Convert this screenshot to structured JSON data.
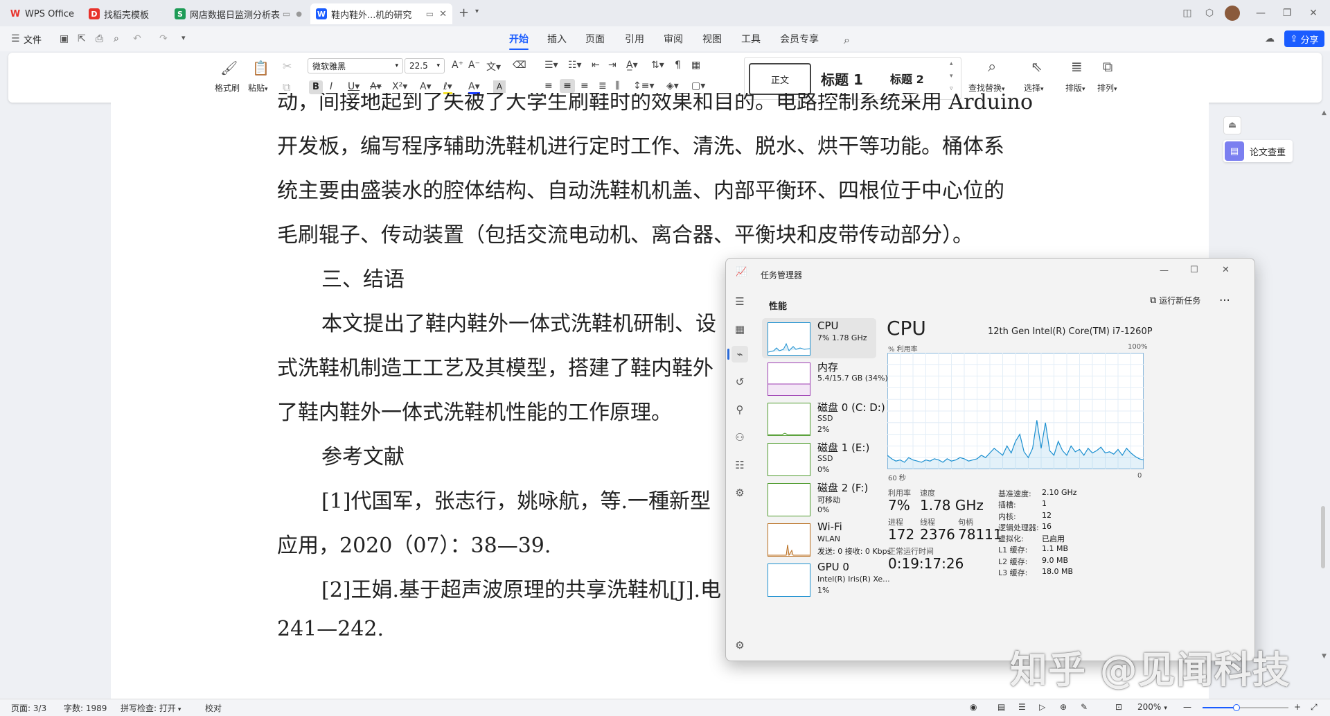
{
  "tabs": [
    {
      "label": "WPS Office",
      "icon": "wps-logo-icon",
      "color": "#e8322b"
    },
    {
      "label": "找稻壳模板",
      "icon": "docer-icon",
      "color": "#e8322b"
    },
    {
      "label": "网店数据日监测分析表",
      "icon": "spreadsheet-icon",
      "color": "#1d9b56"
    },
    {
      "label": "鞋内鞋外...机的研究",
      "icon": "writer-icon",
      "color": "#1a5cff"
    }
  ],
  "menu": {
    "file": "文件",
    "items": [
      "开始",
      "插入",
      "页面",
      "引用",
      "审阅",
      "视图",
      "工具",
      "会员专享"
    ],
    "active": "开始",
    "share": "分享"
  },
  "ribbon": {
    "format_painter": "格式刷",
    "paste": "粘贴",
    "font_name": "微软雅黑",
    "font_size": "22.5",
    "styles": [
      "正文",
      "标题 1",
      "标题 2"
    ],
    "find_replace": "查找替换",
    "select": "选择",
    "layout": "排版",
    "arrange": "排列"
  },
  "document": {
    "lines": [
      "动，间接地起到了失被了大学生刷鞋时的效果和目的。电路控制系统采用 Arduino",
      "开发板，编写程序辅助洗鞋机进行定时工作、清洗、脱水、烘干等功能。桶体系",
      "统主要由盛装水的腔体结构、自动洗鞋机机盖、内部平衡环、四根位于中心位的",
      "毛刷辊子、传动装置（包括交流电动机、离合器、平衡块和皮带传动部分）。",
      "三、结语",
      "本文提出了鞋内鞋外一体式洗鞋机研制、设",
      "式洗鞋机制造工工艺及其模型，搭建了鞋内鞋外",
      "了鞋内鞋外一体式洗鞋机性能的工作原理。",
      "参考文献",
      "[1]代国军，张志行，姚咏航，等.一種新型",
      "应用，2020（07）：38—39.",
      "[2]王娟.基于超声波原理的共享洗鞋机[J].电",
      "241—242."
    ]
  },
  "side_panel": {
    "paper_check": "论文查重"
  },
  "task_manager": {
    "title": "任务管理器",
    "section": "性能",
    "run_new_task": "运行新任务",
    "items": [
      {
        "title": "CPU",
        "lines": [
          "7% 1.78 GHz"
        ]
      },
      {
        "title": "内存",
        "lines": [
          "5.4/15.7 GB (34%)"
        ]
      },
      {
        "title": "磁盘 0 (C: D:)",
        "lines": [
          "SSD",
          "2%"
        ]
      },
      {
        "title": "磁盘 1 (E:)",
        "lines": [
          "SSD",
          "0%"
        ]
      },
      {
        "title": "磁盘 2 (F:)",
        "lines": [
          "可移动",
          "0%"
        ]
      },
      {
        "title": "Wi-Fi",
        "lines": [
          "WLAN",
          "发送: 0 接收: 0 Kbps"
        ]
      },
      {
        "title": "GPU 0",
        "lines": [
          "Intel(R) Iris(R) Xe...",
          "1%"
        ]
      }
    ],
    "cpu": {
      "heading": "CPU",
      "model": "12th Gen Intel(R) Core(TM) i7-1260P",
      "util_label": "% 利用率",
      "max_label": "100%",
      "time_label": "60 秒",
      "zero_label": "0",
      "stats": [
        {
          "label": "利用率",
          "value": "7%"
        },
        {
          "label": "速度",
          "value": "1.78 GHz"
        },
        {
          "label": "进程",
          "value": "172"
        },
        {
          "label": "线程",
          "value": "2376"
        },
        {
          "label": "句柄",
          "value": "78111"
        }
      ],
      "uptime_label": "正常运行时间",
      "uptime": "0:19:17:26",
      "right_stats": [
        {
          "label": "基准速度:",
          "value": "2.10 GHz"
        },
        {
          "label": "插槽:",
          "value": "1"
        },
        {
          "label": "内核:",
          "value": "12"
        },
        {
          "label": "逻辑处理器:",
          "value": "16"
        },
        {
          "label": "虚拟化:",
          "value": "已启用"
        },
        {
          "label": "L1 缓存:",
          "value": "1.1 MB"
        },
        {
          "label": "L2 缓存:",
          "value": "9.0 MB"
        },
        {
          "label": "L3 缓存:",
          "value": "18.0 MB"
        }
      ]
    }
  },
  "chart_data": {
    "type": "line",
    "xlabel": "60 秒",
    "ylabel": "% 利用率",
    "ylim": [
      0,
      100
    ],
    "x": [
      60,
      59,
      58,
      57,
      56,
      55,
      54,
      53,
      52,
      51,
      50,
      49,
      48,
      47,
      46,
      45,
      44,
      43,
      42,
      41,
      40,
      39,
      38,
      37,
      36,
      35,
      34,
      33,
      32,
      31,
      30,
      29,
      28,
      27,
      26,
      25,
      24,
      23,
      22,
      21,
      20,
      19,
      18,
      17,
      16,
      15,
      14,
      13,
      12,
      11,
      10,
      9,
      8,
      7,
      6,
      5,
      4,
      3,
      2,
      1,
      0
    ],
    "series": [
      {
        "values": [
          12,
          9,
          7,
          8,
          6,
          10,
          8,
          7,
          6,
          8,
          7,
          9,
          8,
          6,
          9,
          7,
          8,
          10,
          9,
          7,
          8,
          9,
          12,
          10,
          14,
          18,
          15,
          12,
          20,
          14,
          24,
          30,
          15,
          10,
          18,
          42,
          18,
          40,
          16,
          12,
          24,
          16,
          12,
          20,
          15,
          17,
          12,
          18,
          14,
          16,
          19,
          14,
          15,
          13,
          17,
          12,
          18,
          14,
          11,
          9,
          8
        ]
      }
    ],
    "grid": true,
    "color": "#1a8fd0"
  },
  "status_bar": {
    "page": "页面: 3/3",
    "words": "字数: 1989",
    "spell": "拼写检查: 打开",
    "proof": "校对",
    "zoom": "200%"
  },
  "watermark": "知乎 @见闻科技"
}
